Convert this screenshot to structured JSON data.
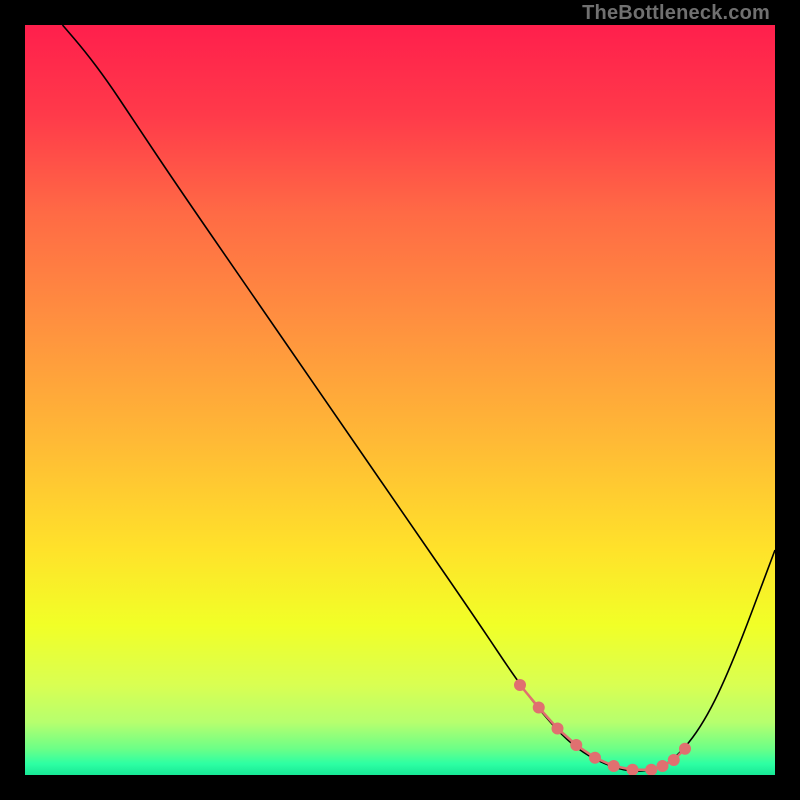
{
  "watermark": "TheBottleneck.com",
  "chart_data": {
    "type": "line",
    "title": "",
    "xlabel": "",
    "ylabel": "",
    "xlim": [
      0,
      100
    ],
    "ylim": [
      0,
      100
    ],
    "grid": false,
    "series": [
      {
        "name": "curve",
        "color": "#000000",
        "width": 1.6,
        "x": [
          5,
          8,
          11,
          14,
          20,
          30,
          40,
          50,
          60,
          66,
          70,
          73,
          76,
          80,
          83,
          86,
          90,
          94,
          100
        ],
        "y": [
          100,
          96.5,
          92.5,
          88,
          79,
          64.5,
          50,
          35.5,
          21,
          12,
          7,
          4,
          2,
          0.5,
          0.5,
          1.5,
          6,
          14,
          30
        ]
      },
      {
        "name": "marker-band",
        "color": "#e07070",
        "marker_radius": 6,
        "line_width": 2.5,
        "x": [
          66,
          68.5,
          71,
          73.5,
          76,
          78.5,
          81,
          83.5,
          85,
          86.5,
          88
        ],
        "y": [
          12,
          9,
          6.2,
          4,
          2.3,
          1.2,
          0.7,
          0.7,
          1.2,
          2.0,
          3.5
        ]
      }
    ],
    "gradient_stops": [
      {
        "offset": 0.0,
        "color": "#ff1f4c"
      },
      {
        "offset": 0.12,
        "color": "#ff3a4a"
      },
      {
        "offset": 0.25,
        "color": "#ff6a45"
      },
      {
        "offset": 0.4,
        "color": "#ff913f"
      },
      {
        "offset": 0.55,
        "color": "#ffb836"
      },
      {
        "offset": 0.7,
        "color": "#ffe22a"
      },
      {
        "offset": 0.8,
        "color": "#f1ff27"
      },
      {
        "offset": 0.88,
        "color": "#d9ff52"
      },
      {
        "offset": 0.93,
        "color": "#b6ff6e"
      },
      {
        "offset": 0.965,
        "color": "#6cff87"
      },
      {
        "offset": 0.985,
        "color": "#2dffa3"
      },
      {
        "offset": 1.0,
        "color": "#17e896"
      }
    ]
  }
}
